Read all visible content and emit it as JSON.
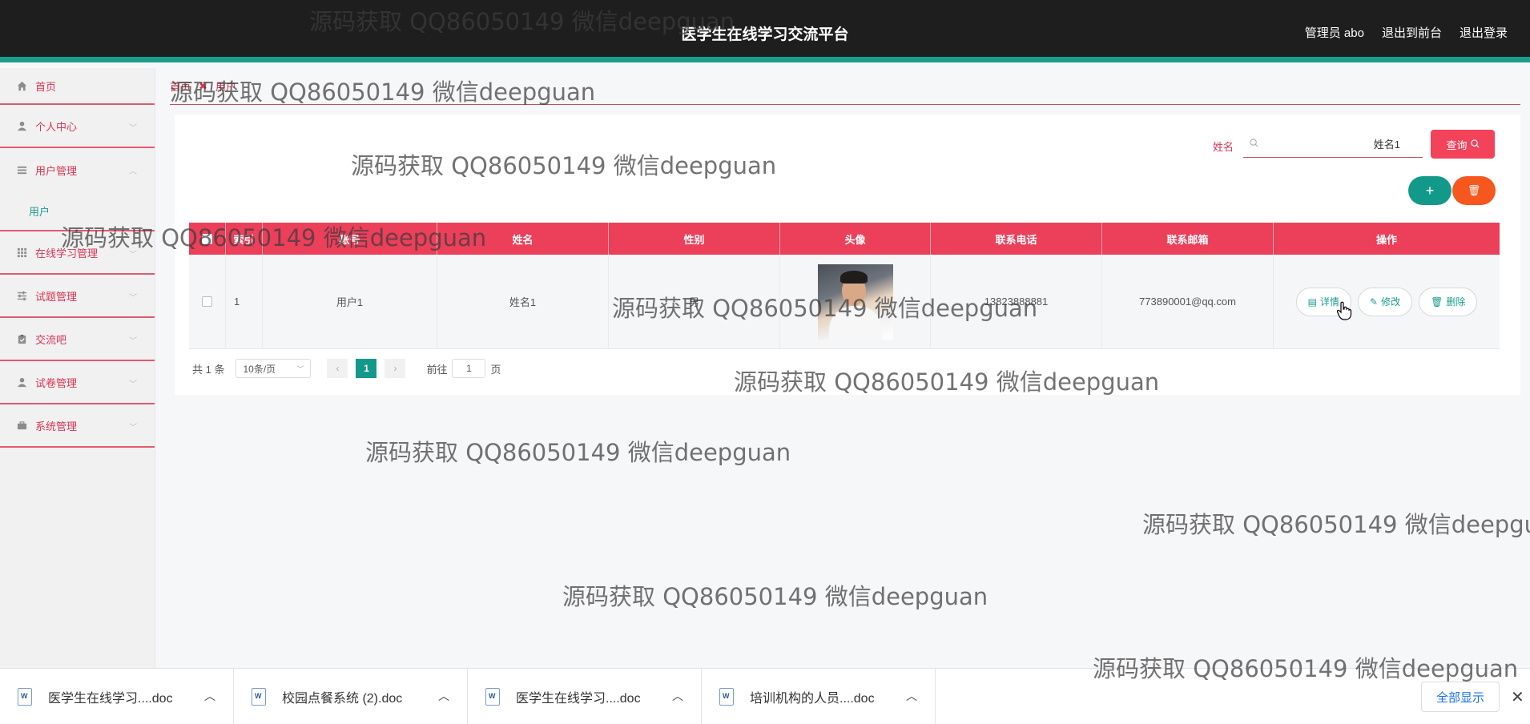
{
  "header": {
    "title": "医学生在线学习交流平台",
    "user_label": "管理员 abo",
    "to_front": "退出到前台",
    "logout": "退出登录"
  },
  "sidebar": {
    "items": [
      {
        "label": "首页",
        "icon": "home-icon"
      },
      {
        "label": "个人中心",
        "icon": "person-icon"
      },
      {
        "label": "用户管理",
        "icon": "menu-icon",
        "expanded": true,
        "sub": [
          {
            "label": "用户"
          }
        ]
      },
      {
        "label": "在线学习管理",
        "icon": "grid-icon"
      },
      {
        "label": "试题管理",
        "icon": "sliders-icon"
      },
      {
        "label": "交流吧",
        "icon": "clipboard-icon"
      },
      {
        "label": "试卷管理",
        "icon": "person-icon"
      },
      {
        "label": "系统管理",
        "icon": "briefcase-icon"
      }
    ]
  },
  "breadcrumb": {
    "home": "首页",
    "current": "用户"
  },
  "search": {
    "label": "姓名",
    "value": "姓名1",
    "query_button": "查询"
  },
  "actions": {
    "add": "+",
    "delete": "🗑"
  },
  "table": {
    "columns": [
      "索引",
      "账号",
      "姓名",
      "性别",
      "头像",
      "联系电话",
      "联系邮箱",
      "操作"
    ],
    "rows": [
      {
        "index": "1",
        "account": "用户1",
        "name": "姓名1",
        "sex": "男",
        "phone": "13823888881",
        "email": "773890001@qq.com",
        "ops": [
          "详情",
          "修改",
          "删除"
        ]
      }
    ]
  },
  "pager": {
    "total": "共 1 条",
    "page_size": "10条/页",
    "current_page": "1",
    "goto_label": "前往",
    "goto_value": "1",
    "page_suffix": "页"
  },
  "downloads": {
    "items": [
      {
        "name": "医学生在线学习....doc"
      },
      {
        "name": "校园点餐系统 (2).doc"
      },
      {
        "name": "医学生在线学习....doc"
      },
      {
        "name": "培训机构的人员....doc"
      }
    ],
    "show_all": "全部显示",
    "close": "✕"
  },
  "watermark": "源码获取 QQ86050149 微信deepguan",
  "colors": {
    "header_bg": "#1e1e1e",
    "accent_teal": "#1a9c8c",
    "primary_red": "#ec3f5a",
    "delete_orange": "#f6571e"
  }
}
